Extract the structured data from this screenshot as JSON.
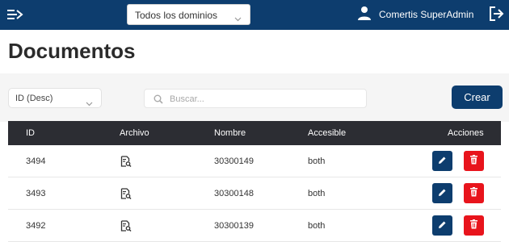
{
  "header": {
    "domain_select_value": "Todos los dominios",
    "user_name": "Comertis SuperAdmin"
  },
  "page": {
    "title": "Documentos"
  },
  "filters": {
    "sort_value": "ID (Desc)",
    "search_placeholder": "Buscar...",
    "create_label": "Crear"
  },
  "table": {
    "columns": [
      "ID",
      "Archivo",
      "Nombre",
      "Accesible",
      "Acciones"
    ],
    "rows": [
      {
        "id": "3494",
        "nombre": "30300149",
        "accesible": "both"
      },
      {
        "id": "3493",
        "nombre": "30300148",
        "accesible": "both"
      },
      {
        "id": "3492",
        "nombre": "30300139",
        "accesible": "both"
      }
    ]
  },
  "colors": {
    "brand": "#0d3d6e",
    "table_header": "#2c2d33",
    "delete": "#e8141c"
  },
  "icons": {
    "menu": "menu-toggle-icon",
    "user": "user-icon",
    "logout": "logout-icon",
    "search": "search-icon",
    "file": "file-search-icon",
    "edit": "pencil-icon",
    "delete": "trash-icon"
  }
}
